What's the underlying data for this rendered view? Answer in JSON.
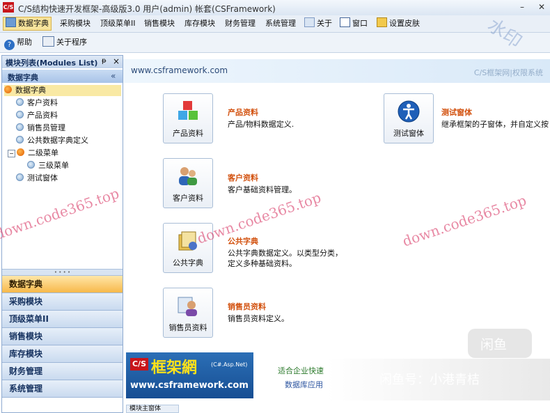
{
  "window": {
    "title": "C/S结构快速开发框架-高级版3.0 用户(admin) 帐套(CSFramework)",
    "logo_text": "C/S"
  },
  "menu": {
    "items": [
      {
        "label": "数据字典",
        "active": true
      },
      {
        "label": "采购模块"
      },
      {
        "label": "顶级菜单II"
      },
      {
        "label": "销售模块"
      },
      {
        "label": "库存模块"
      },
      {
        "label": "财务管理"
      },
      {
        "label": "系统管理"
      },
      {
        "label": "关于"
      },
      {
        "label": "窗口"
      },
      {
        "label": "设置皮肤"
      }
    ]
  },
  "toolbar": {
    "help_label": "帮助",
    "about_label": "关于程序"
  },
  "module_panel": {
    "title": "模块列表(Modules List)",
    "pin_glyph": "ᵽ",
    "close_glyph": "×",
    "group_title": "数据字典",
    "collapse_glyph": "«",
    "tree": [
      {
        "label": "数据字典"
      },
      {
        "label": "客户资料"
      },
      {
        "label": "产品资料"
      },
      {
        "label": "销售员管理"
      },
      {
        "label": "公共数据字典定义"
      },
      {
        "label": "二级菜单"
      },
      {
        "label": "三级菜单"
      },
      {
        "label": "测试窗体"
      }
    ],
    "nav": [
      {
        "label": "数据字典"
      },
      {
        "label": "采购模块"
      },
      {
        "label": "顶级菜单II"
      },
      {
        "label": "销售模块"
      },
      {
        "label": "库存模块"
      },
      {
        "label": "财务管理"
      },
      {
        "label": "系统管理"
      }
    ]
  },
  "main": {
    "site_url": "www.csframework.com",
    "slogan": "C/S框架网|权限系统",
    "items": [
      {
        "tile": "产品资料",
        "title": "产品资料",
        "desc": [
          "产品/物料数据定义."
        ]
      },
      {
        "tile": "客户资料",
        "title": "客户资料",
        "desc": [
          "客户基础资料管理。"
        ]
      },
      {
        "tile": "公共字典",
        "title": "公共字典",
        "desc": [
          "公共字典数据定义。以类型分类，",
          "定义多种基础资料。"
        ]
      },
      {
        "tile": "销售员资料",
        "title": "销售员资料",
        "desc": [
          "销售员资料定义。"
        ]
      },
      {
        "tile": "测试窗体",
        "title": "测试窗体",
        "desc": [
          "继承框架的子窗体，并自定义按"
        ]
      }
    ],
    "bottom_logo": {
      "cs": "C/S",
      "name": "框架網",
      "sub": "(C#.Asp.Net)",
      "url": "www.csframework.com"
    },
    "bottom_note1": "适合企业快速",
    "bottom_note2": "数据库应用",
    "bottom_tab": "模块主窗体"
  },
  "watermarks": {
    "site": "down.code365.top",
    "stamp": "水印",
    "badge": "闲鱼",
    "author": "闲鱼号：小港青桔"
  }
}
